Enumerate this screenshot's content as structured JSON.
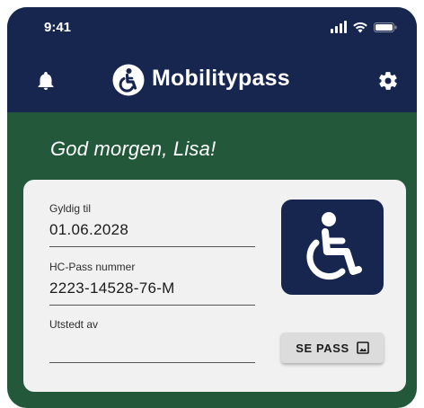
{
  "status_bar": {
    "time": "9:41",
    "icons": [
      "signal-icon",
      "wifi-icon",
      "battery-icon"
    ]
  },
  "header": {
    "app_name": "Mobilitypass",
    "left_icon": "bell-icon",
    "right_icon": "gear-icon",
    "logo_icon": "wheelchair-logo-icon"
  },
  "greeting": "God morgen, Lisa!",
  "card": {
    "fields": [
      {
        "label": "Gyldig til",
        "value": "01.06.2028"
      },
      {
        "label": "HC-Pass nummer",
        "value": "2223-14528-76-M"
      },
      {
        "label": "Utstedt av",
        "value": ""
      }
    ],
    "tile_icon": "wheelchair-icon",
    "button_label": "SE PASS",
    "button_icon": "image-icon"
  },
  "colors": {
    "header_bg": "#16264f",
    "page_bg": "#24583b",
    "card_bg": "#f1f1f1",
    "button_bg": "#dcdcdc"
  }
}
